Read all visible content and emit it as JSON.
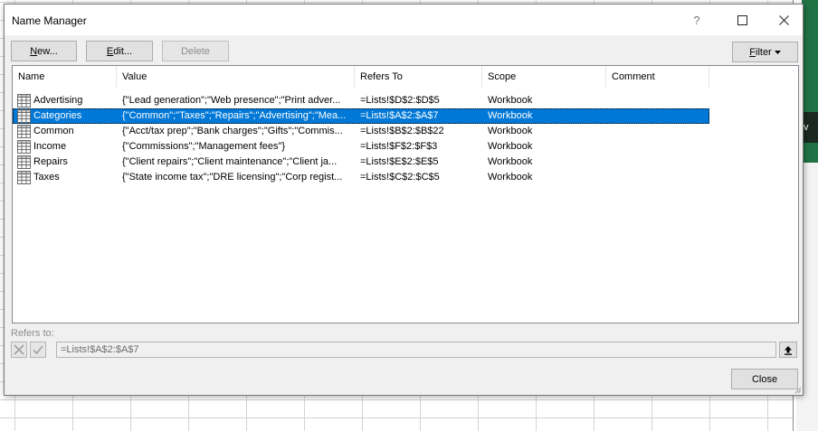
{
  "dialog": {
    "title": "Name Manager",
    "help_glyph": "?",
    "buttons": {
      "new": {
        "label": "New...",
        "accel": "N",
        "rest": "ew..."
      },
      "edit": {
        "label": "Edit...",
        "accel": "E",
        "rest": "dit..."
      },
      "delete": {
        "label": "Delete"
      },
      "filter": {
        "label": "Filter",
        "accel": "F",
        "rest": "ilter"
      },
      "close": {
        "label": "Close"
      }
    },
    "columns": [
      "Name",
      "Value",
      "Refers To",
      "Scope",
      "Comment"
    ],
    "rows": [
      {
        "name": "Advertising",
        "value": "{\"Lead generation\";\"Web presence\";\"Print adver...",
        "refers_to": "=Lists!$D$2:$D$5",
        "scope": "Workbook",
        "comment": "",
        "selected": false
      },
      {
        "name": "Categories",
        "value": "{\"Common\";\"Taxes\";\"Repairs\";\"Advertising\";\"Mea...",
        "refers_to": "=Lists!$A$2:$A$7",
        "scope": "Workbook",
        "comment": "",
        "selected": true
      },
      {
        "name": "Common",
        "value": "{\"Acct/tax prep\";\"Bank charges\";\"Gifts\";\"Commis...",
        "refers_to": "=Lists!$B$2:$B$22",
        "scope": "Workbook",
        "comment": "",
        "selected": false
      },
      {
        "name": "Income",
        "value": "{\"Commissions\";\"Management fees\"}",
        "refers_to": "=Lists!$F$2:$F$3",
        "scope": "Workbook",
        "comment": "",
        "selected": false
      },
      {
        "name": "Repairs",
        "value": "{\"Client repairs\";\"Client maintenance\";\"Client ja...",
        "refers_to": "=Lists!$E$2:$E$5",
        "scope": "Workbook",
        "comment": "",
        "selected": false
      },
      {
        "name": "Taxes",
        "value": "{\"State income tax\";\"DRE licensing\";\"Corp regist...",
        "refers_to": "=Lists!$C$2:$C$5",
        "scope": "Workbook",
        "comment": "",
        "selected": false
      }
    ],
    "refers_to_label": "Refers to:",
    "refers_to_value": "=Lists!$A$2:$A$7"
  },
  "background": {
    "side_panel_glyph": "v"
  },
  "colors": {
    "selection": "#0078d7",
    "excel_green": "#217346",
    "dialog_bg": "#f0f0f0"
  },
  "icons": {
    "titlebar": [
      "maximize-icon",
      "close-icon"
    ],
    "row": "named-range-icon",
    "refers": [
      "cancel-x-icon",
      "confirm-check-icon",
      "collapse-dialog-icon"
    ],
    "filter": "dropdown-arrow-icon"
  }
}
